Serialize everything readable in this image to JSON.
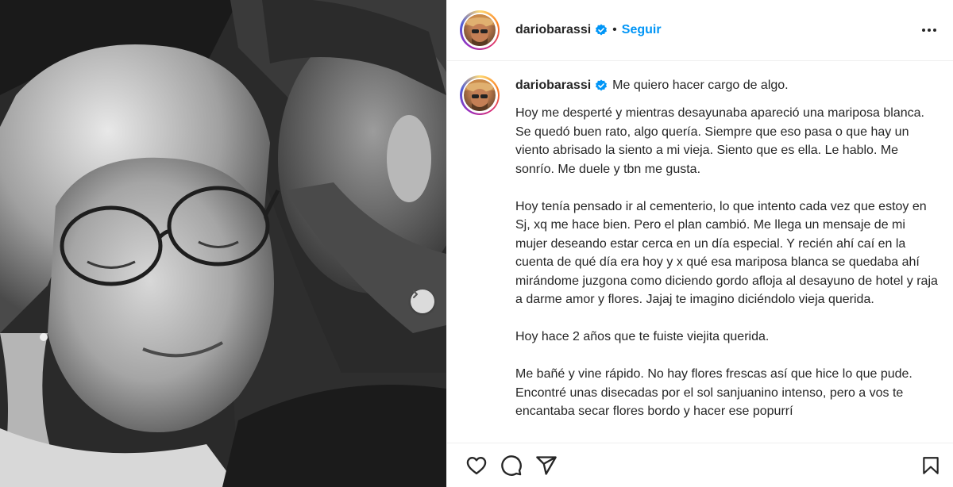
{
  "post": {
    "username": "dariobarassi",
    "follow_label": "Seguir",
    "separator": "•",
    "verified_icon": "verified-badge-icon",
    "caption_title": "Me quiero hacer cargo de algo.",
    "paragraphs": [
      "Hoy me desperté y mientras desayunaba apareció una mariposa blanca. Se quedó buen rato, algo quería. Siempre que eso pasa o que hay un viento abrisado la siento a mi vieja. Siento que es ella. Le hablo. Me sonrío. Me duele y tbn me gusta.",
      "Hoy tenía pensado ir al cementerio, lo que intento cada vez que estoy en Sj, xq me hace bien. Pero el plan cambió. Me llega un mensaje de mi mujer deseando estar cerca en un día especial. Y recién ahí caí en la cuenta de qué día era hoy y x qué esa mariposa blanca se quedaba ahí mirándome juzgona como diciendo gordo afloja al desayuno de hotel y raja a darme amor y flores. Jajaj te imagino diciéndolo vieja querida.",
      "Hoy hace 2 años que te fuiste viejita querida.",
      "Me bañé y vine rápido. No hay flores frescas así que hice lo que pude. Encontré unas disecadas por el sol sanjuanino intenso, pero a vos te encantaba secar flores bordo y hacer ese popurrí"
    ]
  },
  "icons": {
    "like": "heart-icon",
    "comment": "comment-icon",
    "share": "share-icon",
    "save": "bookmark-icon",
    "more": "more-options-icon",
    "carousel_next": "chevron-right-icon"
  },
  "colors": {
    "accent": "#0095f6",
    "text": "#262626",
    "border": "#efefef"
  }
}
